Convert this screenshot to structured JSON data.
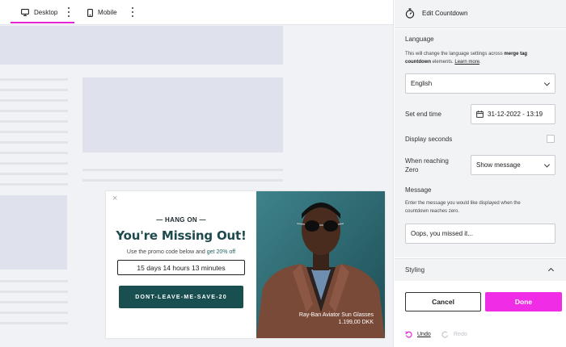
{
  "canvas": {
    "tabs": [
      {
        "label": "Desktop",
        "icon": "monitor-icon",
        "active": true
      },
      {
        "label": "Mobile",
        "icon": "mobile-phone-icon",
        "active": false
      }
    ],
    "accent": "#e522d8"
  },
  "popup": {
    "close_icon": "close-icon",
    "eyebrow": "— HANG ON —",
    "headline": "You're Missing Out!",
    "promo_prefix": "Use the promo code below and ",
    "promo_highlight": "get 20% off",
    "countdown": "15 days 14 hours 13 minutes",
    "cta_label": "DONT-LEAVE-ME-SAVE-20",
    "cta_color": "#1a4f52",
    "image_caption_line1": "Ray-Ban Aviator Sun Glasses",
    "image_caption_line2": "1.199,00 DKK"
  },
  "panel": {
    "title": "Edit Countdown",
    "title_icon": "stopwatch-icon",
    "language_label": "Language",
    "language_hint_1": "This will change the language settings across ",
    "language_hint_bold_1": "merge tag",
    "language_hint_2": " and ",
    "language_hint_bold_2": "countdown",
    "language_hint_3": " elements. ",
    "language_hint_link": "Learn more",
    "language_hint_end": ".",
    "language_value": "English",
    "end_time_label": "Set end time",
    "end_time_value": "31-12-2022 - 13:19",
    "display_seconds_label": "Display seconds",
    "display_seconds_checked": false,
    "reaching_zero_label_1": "When reaching",
    "reaching_zero_label_2": "Zero",
    "reaching_zero_value": "Show message",
    "message_label": "Message",
    "message_hint_1": "Enter the message you would like displayed when the",
    "message_hint_2": "countdown reaches zero.",
    "message_value": "Oops, you missed it...",
    "styling_label": "Styling",
    "cancel_label": "Cancel",
    "done_label": "Done",
    "done_color": "#f02ce7",
    "undo_label": "Undo",
    "redo_label": "Redo"
  }
}
